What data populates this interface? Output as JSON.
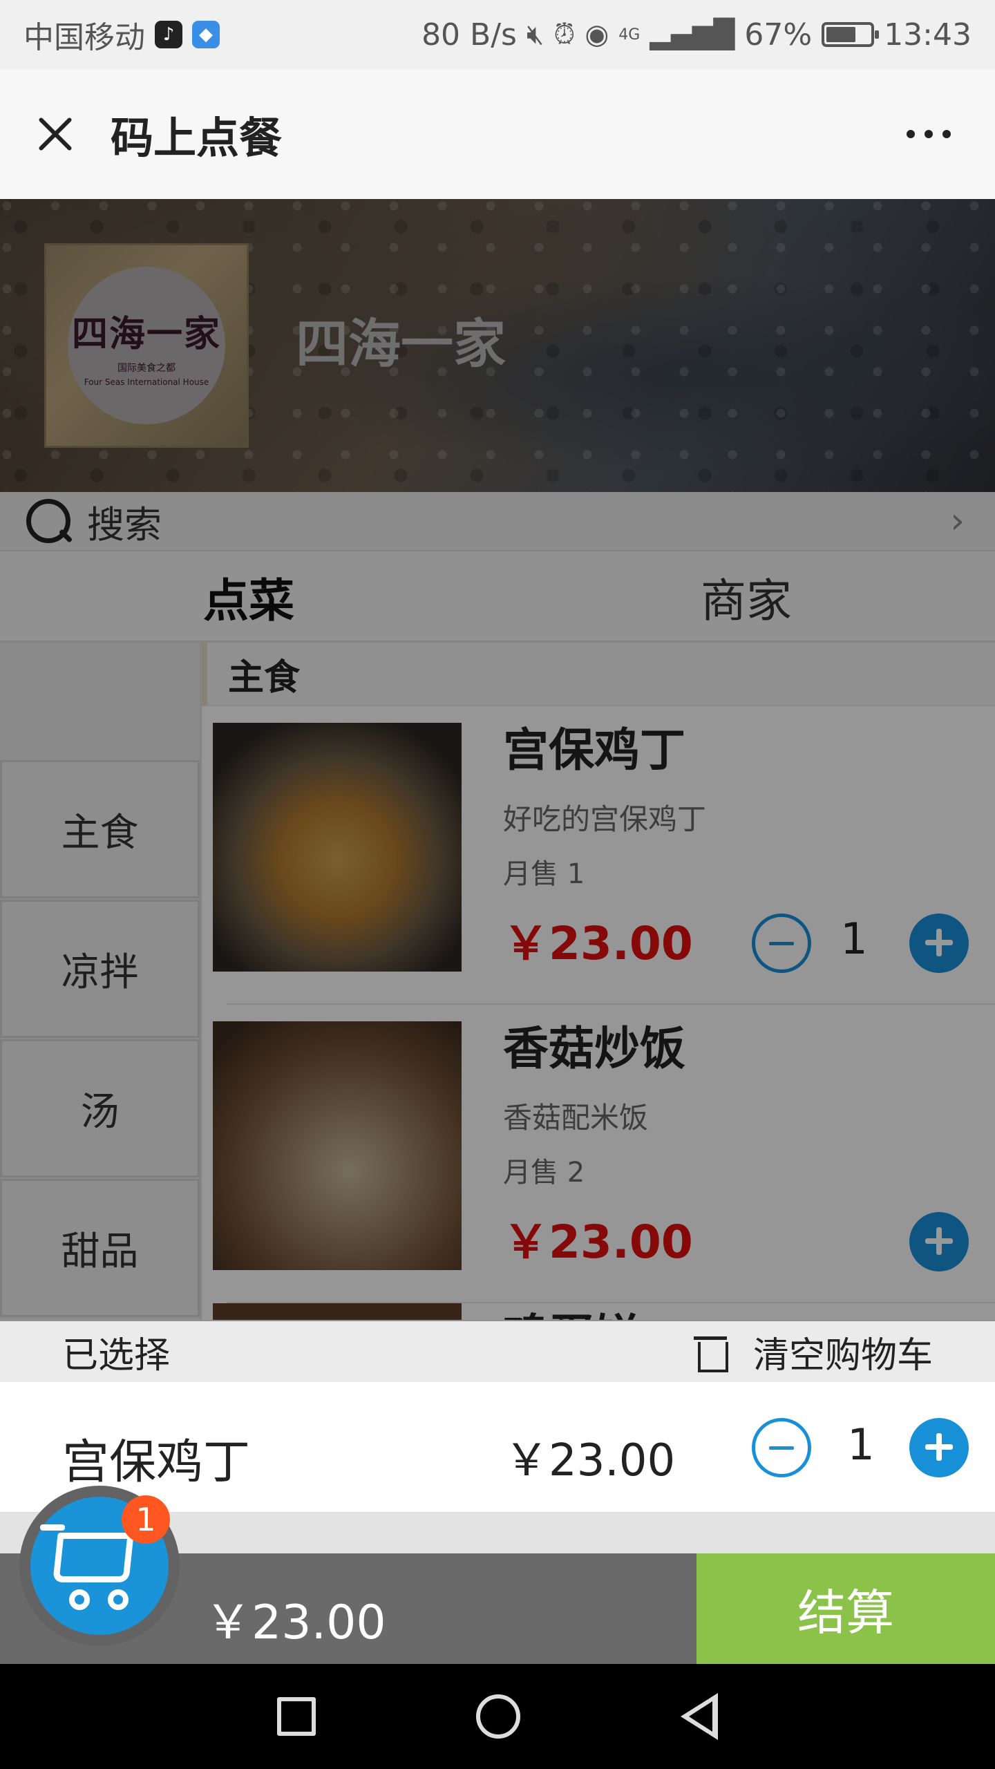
{
  "status_bar": {
    "carrier": "中国移动",
    "speed": "80 B/s",
    "signal": "4G",
    "battery": "67%",
    "battery_level": 0.67,
    "time": "13:43"
  },
  "titlebar": {
    "title": "码上点餐"
  },
  "banner": {
    "shop_name": "四海一家",
    "logo_text": "四海一家",
    "logo_sub": "国际美食之都",
    "logo_en": "Four Seas International House"
  },
  "search": {
    "placeholder": "搜索"
  },
  "tabs": [
    {
      "label": "点菜",
      "active": true
    },
    {
      "label": "商家",
      "active": false
    }
  ],
  "categories": [
    "主食",
    "凉拌",
    "汤",
    "甜品"
  ],
  "menu": {
    "section_title": "主食",
    "dishes": [
      {
        "name": "宫保鸡丁",
        "desc": "好吃的宫保鸡丁",
        "sold": "月售 1",
        "price": "￥23.00",
        "qty": "1"
      },
      {
        "name": "香菇炒饭",
        "desc": "香菇配米饭",
        "sold": "月售 2",
        "price": "￥23.00",
        "qty": ""
      }
    ],
    "peek_name": "鸡蛋饼"
  },
  "cart": {
    "selected_label": "已选择",
    "clear_label": "清空购物车",
    "items": [
      {
        "name": "宫保鸡丁",
        "price": "￥23.00",
        "qty": "1"
      }
    ],
    "badge_count": "1",
    "total": "￥23.00",
    "checkout_label": "结算"
  },
  "colors": {
    "accent_blue": "#1890d8",
    "price_red": "#e01010",
    "checkout_green": "#8bc34a",
    "badge_orange": "#ff5722"
  }
}
